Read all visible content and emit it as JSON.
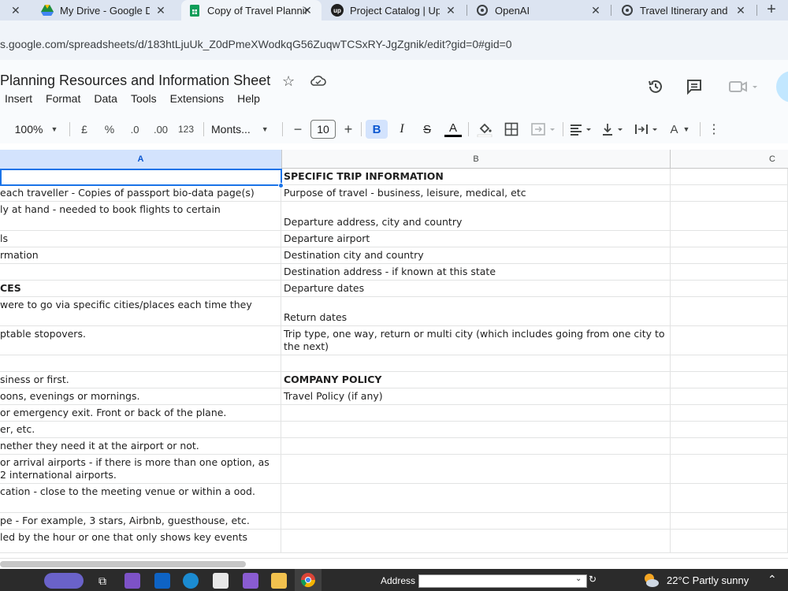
{
  "browser": {
    "tabs": [
      {
        "title": "My Drive - Google Dr",
        "active": false
      },
      {
        "title": "Copy of Travel Plannin",
        "active": true
      },
      {
        "title": "Project Catalog | Upw",
        "active": false
      },
      {
        "title": "OpenAI",
        "active": false
      },
      {
        "title": "Travel Itinerary and E",
        "active": false
      }
    ],
    "new_tab": "+",
    "close_glyph": "✕",
    "url": "s.google.com/spreadsheets/d/183htLjuUk_Z0dPmeXWodkqG56ZuqwTCSxRY-JgZgnik/edit?gid=0#gid=0"
  },
  "doc": {
    "title": "Planning Resources and Information Sheet",
    "menu": [
      "Insert",
      "Format",
      "Data",
      "Tools",
      "Extensions",
      "Help"
    ]
  },
  "toolbar": {
    "zoom": "100%",
    "currency": "£",
    "percent": "%",
    "dec_decrease": ".0",
    "dec_increase": ".00",
    "number_format": "123",
    "font": "Monts...",
    "font_size": "10",
    "bold": "B",
    "italic": "I",
    "strike": "S",
    "text_color": "A",
    "text_rotate": "A"
  },
  "grid": {
    "columns": [
      "A",
      "B",
      "C"
    ],
    "rows": [
      {
        "a": "",
        "b": "SPECIFIC TRIP INFORMATION",
        "b_bold": true
      },
      {
        "a": "each traveller - Copies of passport bio-data page(s)",
        "b": "Purpose of travel - business, leisure, medical, etc"
      },
      {
        "a": "ly at hand - needed to book flights to certain",
        "b": "Departure address, city and country",
        "tall": true
      },
      {
        "a": "ls",
        "b": "Departure airport"
      },
      {
        "a": "rmation",
        "b": "Destination city and country"
      },
      {
        "a": "",
        "b": "Destination address - if known at this state"
      },
      {
        "a": "CES",
        "a_bold": true,
        "b": "Departure dates"
      },
      {
        "a": "were to go via specific cities/places each time they",
        "b": "Return dates",
        "tall": true
      },
      {
        "a": "ptable stopovers.",
        "b": "Trip type, one way, return or multi city (which includes going from one city to the next)",
        "tall": true
      },
      {
        "a": "",
        "b": ""
      },
      {
        "a": "siness or first.",
        "b": "COMPANY POLICY",
        "b_bold": true
      },
      {
        "a": "oons, evenings or mornings.",
        "b": "Travel Policy (if any)"
      },
      {
        "a": "or emergency exit. Front or back of the plane.",
        "b": ""
      },
      {
        "a": "er, etc.",
        "b": ""
      },
      {
        "a": "nether they need it at the airport or not.",
        "b": ""
      },
      {
        "a": "or arrival airports - if there is more than one option, as 2 international airports.",
        "b": "",
        "tall": true
      },
      {
        "a": "cation - close to the meeting venue or within a ood.",
        "b": "",
        "tall": true
      },
      {
        "a": "pe - For example, 3 stars, Airbnb, guesthouse, etc.",
        "b": ""
      },
      {
        "a": "led by the hour or one that only shows key events",
        "b": "",
        "tall": true
      }
    ]
  },
  "taskbar": {
    "address_label": "Address",
    "weather": "22°C  Partly sunny"
  },
  "colors": {
    "selection": "#1a73e8",
    "selected_header": "#d3e3fd",
    "tab_strip": "#dce4f1"
  }
}
